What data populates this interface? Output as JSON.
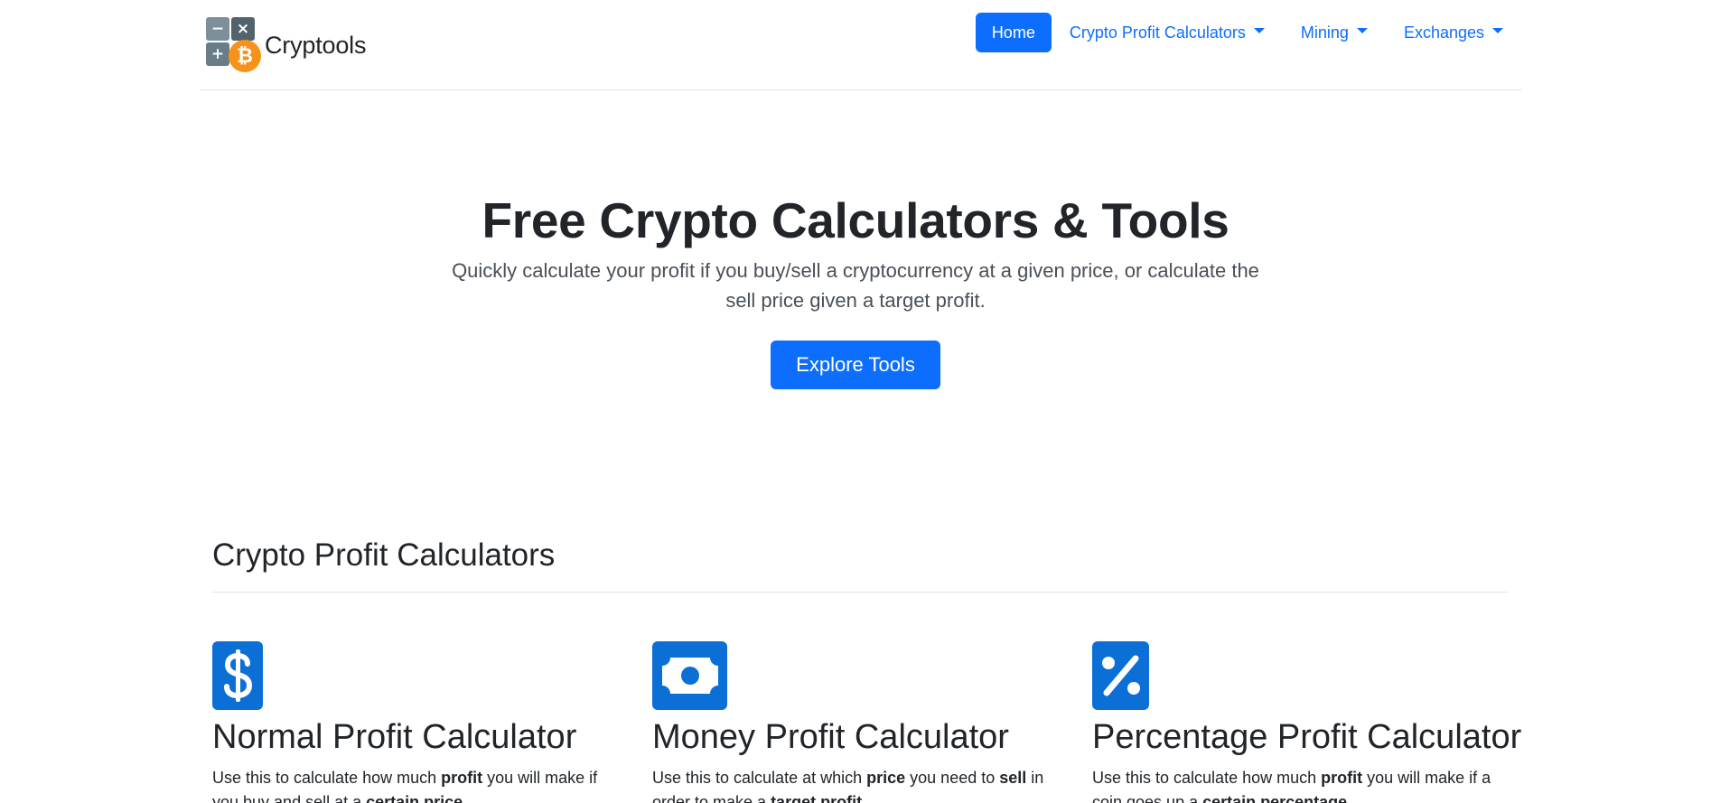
{
  "brand": {
    "name": "Cryptools",
    "logo_symbols": {
      "minus": "−",
      "times": "×",
      "plus": "+",
      "coin": "₿"
    }
  },
  "nav": {
    "items": [
      {
        "label": "Home",
        "active": true,
        "dropdown": false
      },
      {
        "label": "Crypto Profit Calculators",
        "active": false,
        "dropdown": true
      },
      {
        "label": "Mining",
        "active": false,
        "dropdown": true
      },
      {
        "label": "Exchanges",
        "active": false,
        "dropdown": true
      }
    ]
  },
  "hero": {
    "title": "Free Crypto Calculators & Tools",
    "lead": "Quickly calculate your profit if you buy/sell a cryptocurrency at a given price, or calculate the sell price given a target profit.",
    "button_label": "Explore Tools"
  },
  "section": {
    "title": "Crypto Profit Calculators",
    "cards": [
      {
        "icon": "dollar-icon",
        "title": "Normal Profit Calculator",
        "desc_parts": [
          {
            "text": "Use this to calculate how much "
          },
          {
            "text": "profit",
            "bold": true
          },
          {
            "text": " you will make if you buy and sell at a "
          },
          {
            "text": "certain price",
            "bold": true
          },
          {
            "text": "."
          }
        ]
      },
      {
        "icon": "money-bill-icon",
        "title": "Money Profit Calculator",
        "desc_parts": [
          {
            "text": "Use this to calculate at which "
          },
          {
            "text": "price",
            "bold": true
          },
          {
            "text": " you need to "
          },
          {
            "text": "sell",
            "bold": true
          },
          {
            "text": " in order to make a "
          },
          {
            "text": "target profit",
            "bold": true
          },
          {
            "text": "."
          }
        ]
      },
      {
        "icon": "percent-icon",
        "title": "Percentage Profit Calculator",
        "desc_parts": [
          {
            "text": "Use this to calculate how much "
          },
          {
            "text": "profit",
            "bold": true
          },
          {
            "text": " you will make if a coin goes up a "
          },
          {
            "text": "certain percentage",
            "bold": true
          },
          {
            "text": "."
          }
        ]
      }
    ]
  },
  "colors": {
    "primary": "#0d6efd",
    "icon_blue": "#0b6fd6",
    "bitcoin_orange": "#f7931a",
    "text": "#212529",
    "muted": "#495057",
    "border": "#dee2e6"
  }
}
